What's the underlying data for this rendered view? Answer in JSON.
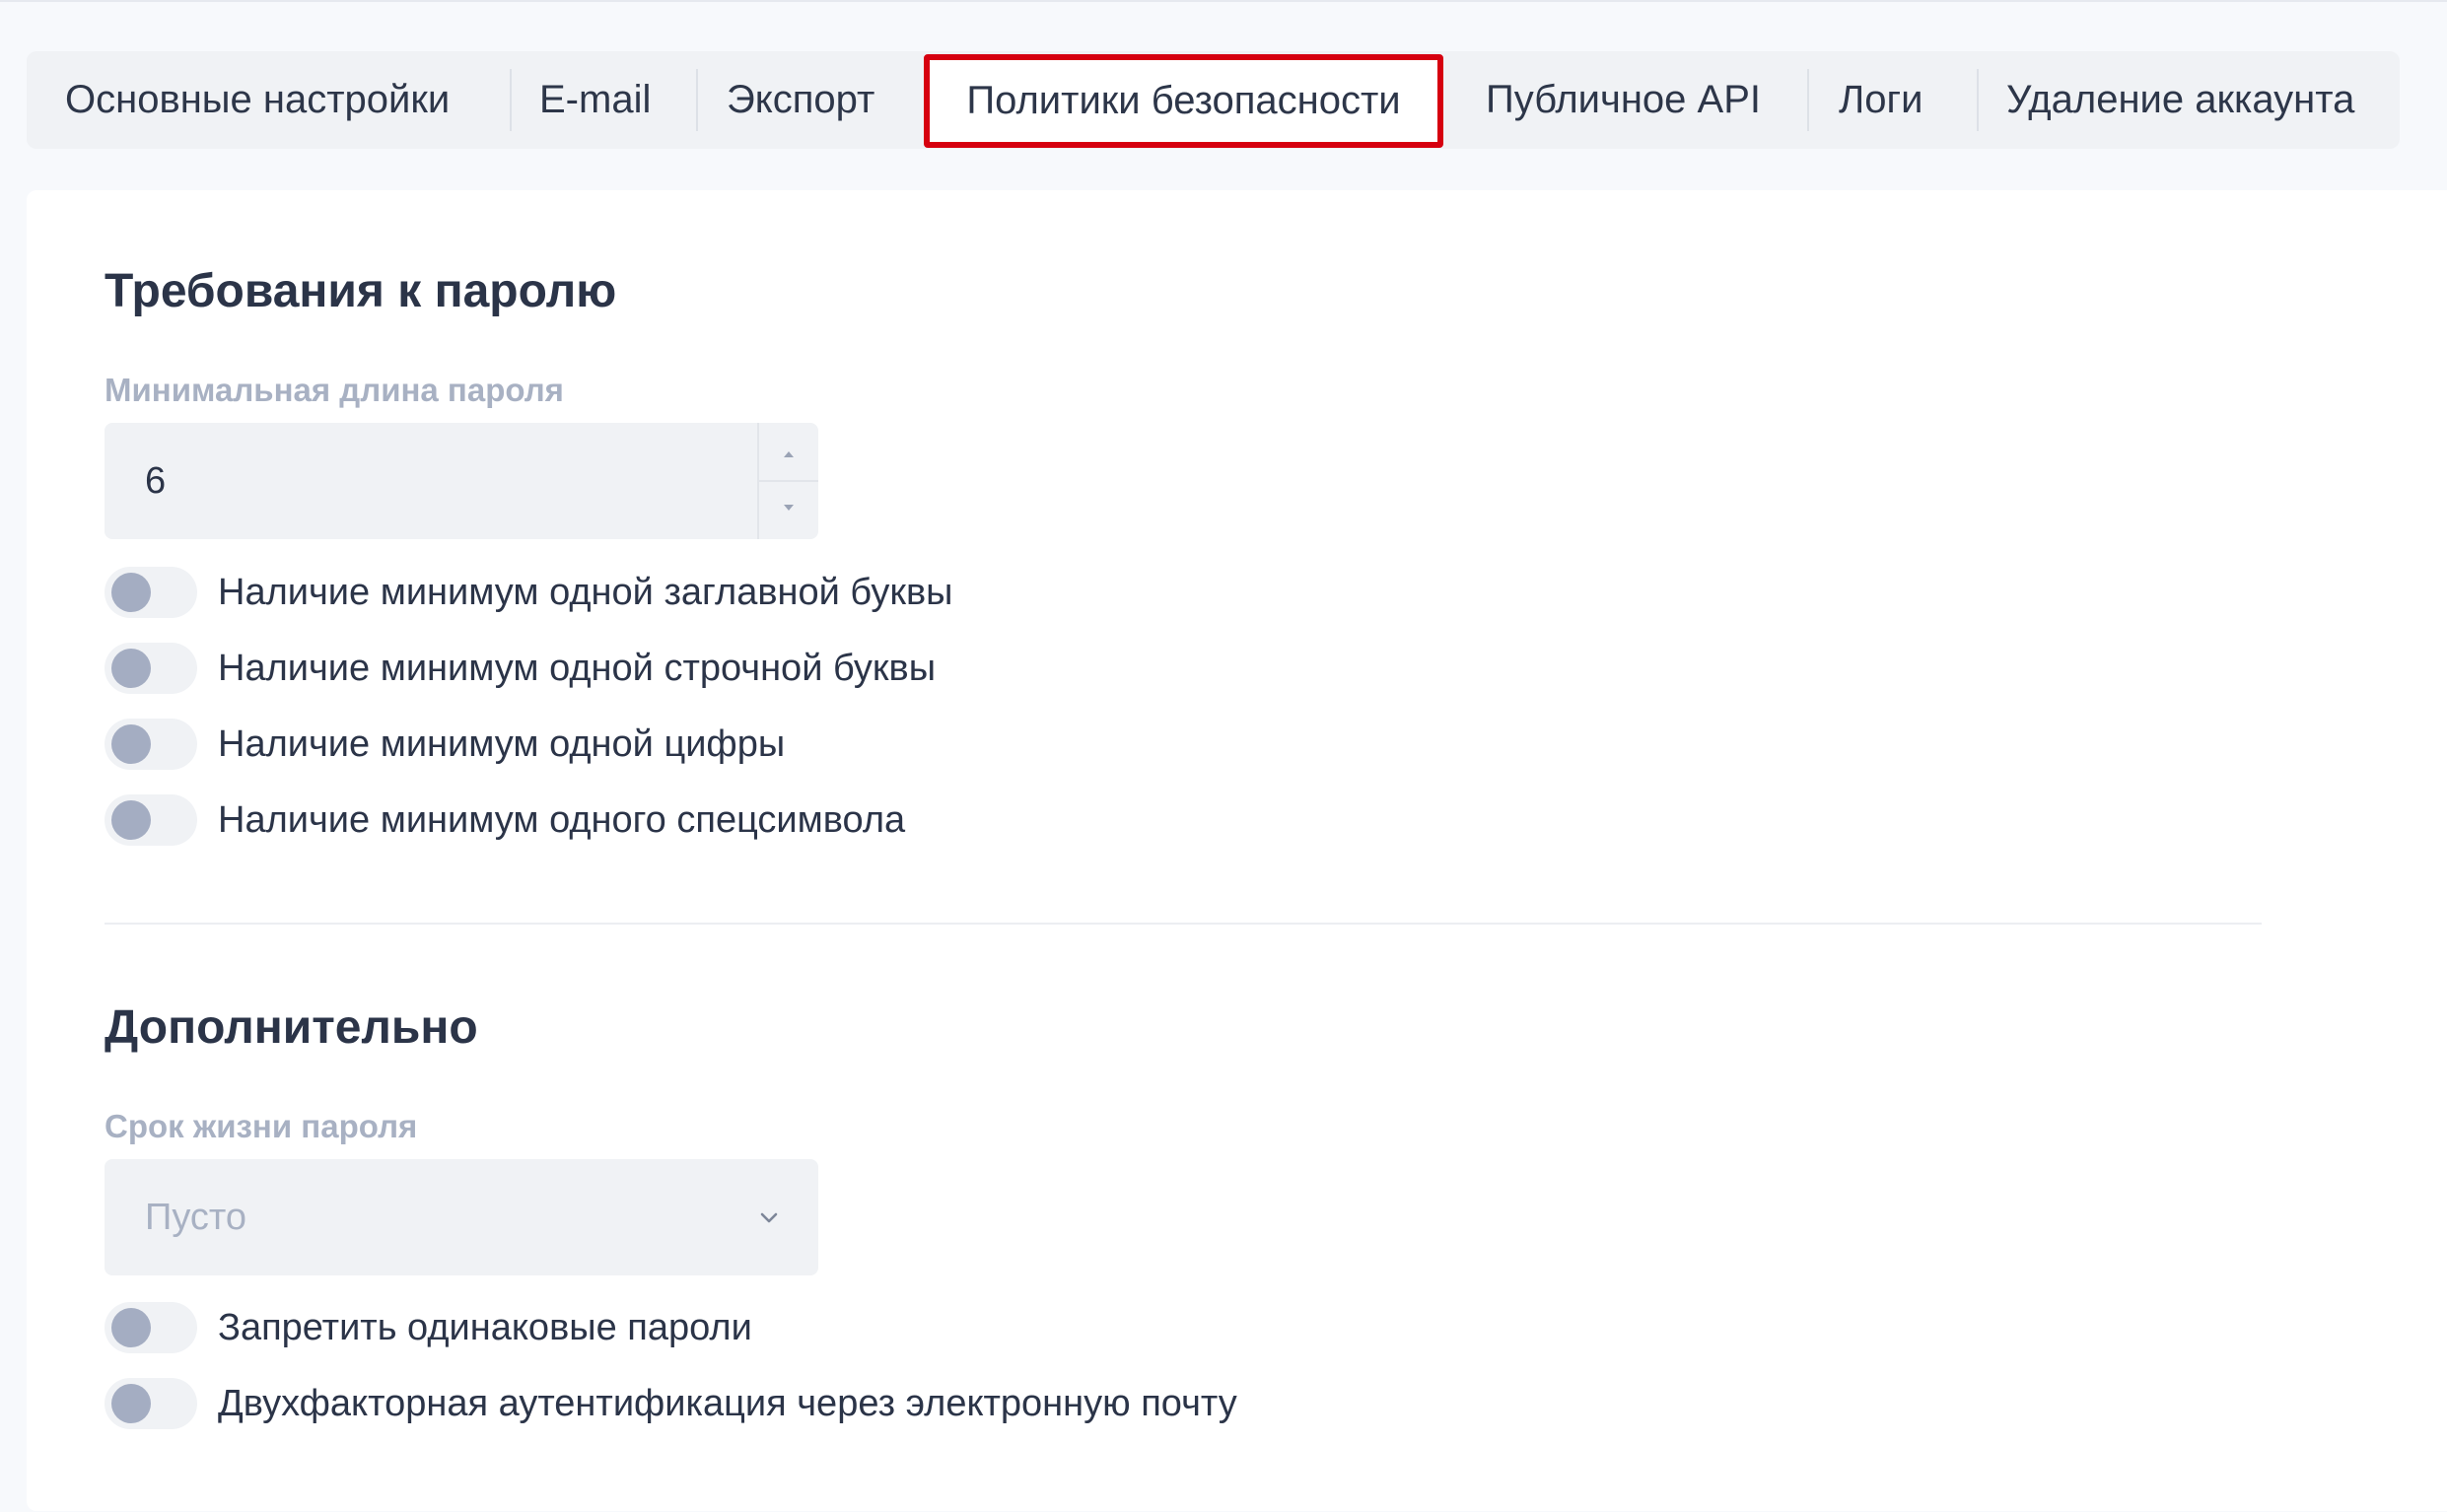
{
  "tabs": [
    {
      "label": "Основные настройки",
      "active": false
    },
    {
      "label": "E-mail",
      "active": false
    },
    {
      "label": "Экспорт",
      "active": false
    },
    {
      "label": "Политики безопасности",
      "active": true
    },
    {
      "label": "Публичное API",
      "active": false
    },
    {
      "label": "Логи",
      "active": false
    },
    {
      "label": "Удаление аккаунта",
      "active": false
    }
  ],
  "password_requirements": {
    "title": "Требования к паролю",
    "min_length_label": "Минимальная длина пароля",
    "min_length_value": "6",
    "toggles": [
      {
        "label": "Наличие минимум одной заглавной буквы",
        "on": false
      },
      {
        "label": "Наличие минимум одной строчной буквы",
        "on": false
      },
      {
        "label": "Наличие минимум одной цифры",
        "on": false
      },
      {
        "label": "Наличие минимум одного спецсимвола",
        "on": false
      }
    ]
  },
  "additional": {
    "title": "Дополнительно",
    "lifetime_label": "Срок жизни пароля",
    "lifetime_value": "Пусто",
    "toggles": [
      {
        "label": "Запретить одинаковые пароли",
        "on": false
      },
      {
        "label": "Двухфакторная аутентификация через электронную почту",
        "on": false
      }
    ]
  },
  "colors": {
    "highlight": "#d6000f",
    "toggle_off_knob": "#a4adc2",
    "label_muted": "#a8b1c3"
  }
}
